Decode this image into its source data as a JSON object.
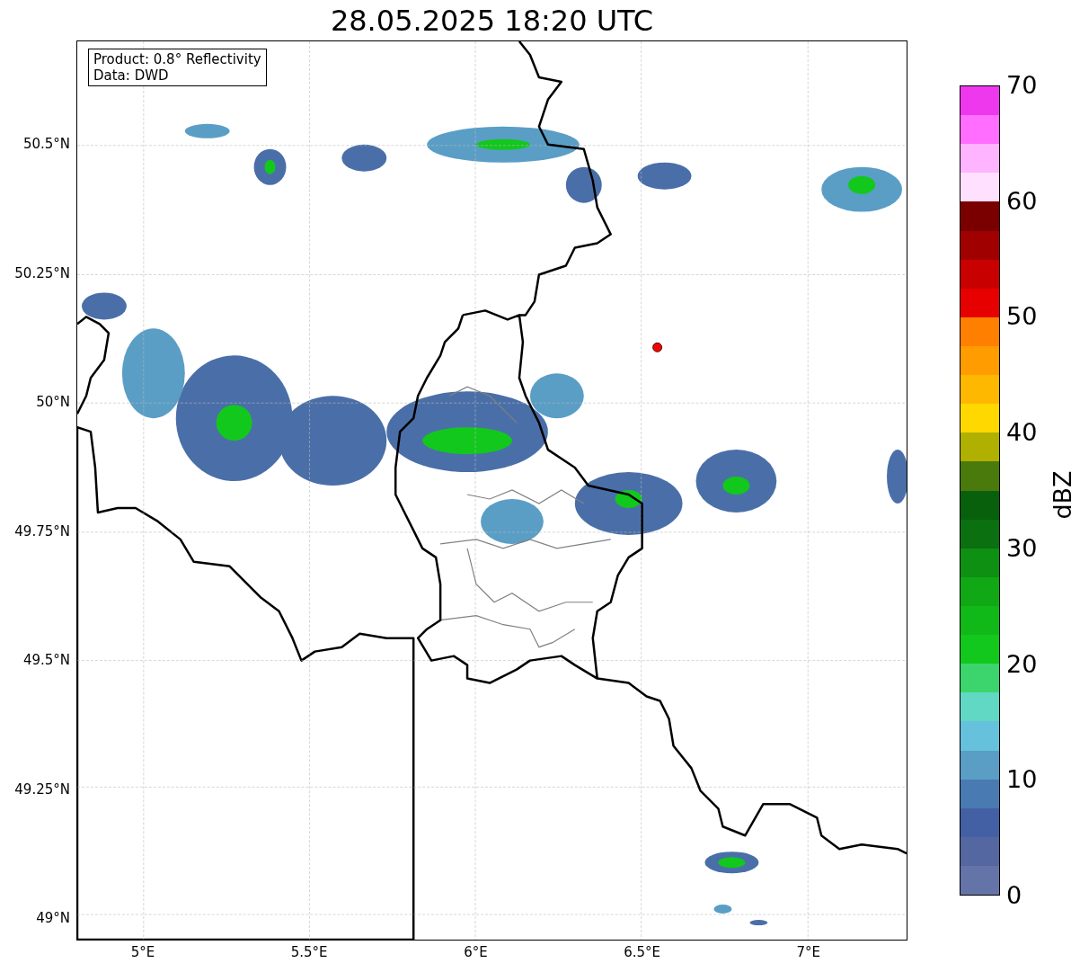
{
  "title": "28.05.2025 18:20 UTC",
  "info_box": {
    "lines": [
      "Product: 0.8° Reflectivity",
      "Data: DWD"
    ]
  },
  "map": {
    "lat_ticks": [
      "50.5°N",
      "50.25°N",
      "50°N",
      "49.75°N",
      "49.5°N",
      "49.25°N",
      "49°N"
    ],
    "lon_ticks": [
      "5°E",
      "5.5°E",
      "6°E",
      "6.5°E",
      "7°E"
    ]
  },
  "colorbar": {
    "label": "dBZ",
    "ticks": [
      "70",
      "60",
      "50",
      "40",
      "30",
      "20",
      "10",
      "0"
    ],
    "segments": [
      {
        "color": "#ee38ee"
      },
      {
        "color": "#ff6eff"
      },
      {
        "color": "#ffb4ff"
      },
      {
        "color": "#ffe0ff"
      },
      {
        "color": "#7a0000"
      },
      {
        "color": "#a00000"
      },
      {
        "color": "#c80000"
      },
      {
        "color": "#e60000"
      },
      {
        "color": "#ff8000"
      },
      {
        "color": "#ff9c00"
      },
      {
        "color": "#ffb800"
      },
      {
        "color": "#ffd800"
      },
      {
        "color": "#b0b000"
      },
      {
        "color": "#4a7a0c"
      },
      {
        "color": "#08600c"
      },
      {
        "color": "#0a7010"
      },
      {
        "color": "#0e9012"
      },
      {
        "color": "#10a814"
      },
      {
        "color": "#10b818"
      },
      {
        "color": "#12c81c"
      },
      {
        "color": "#3cd46c"
      },
      {
        "color": "#60d8c4"
      },
      {
        "color": "#66c2dc"
      },
      {
        "color": "#5a9ec6"
      },
      {
        "color": "#4a7ab2"
      },
      {
        "color": "#4460a4"
      },
      {
        "color": "#5567a0"
      },
      {
        "color": "#6474a8"
      }
    ]
  }
}
